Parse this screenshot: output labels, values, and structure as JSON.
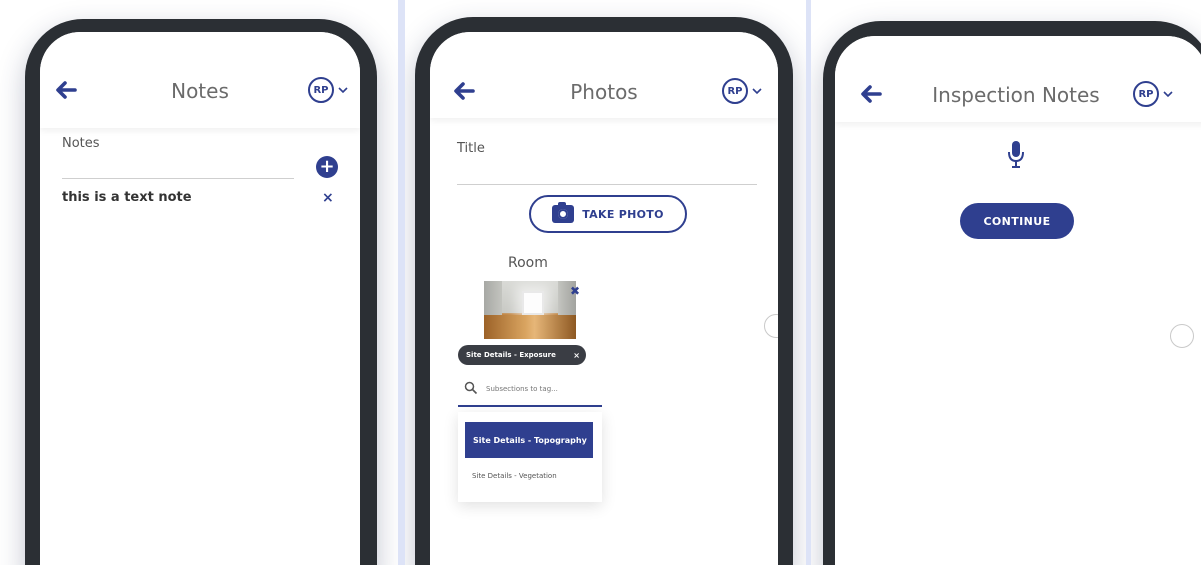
{
  "screens": [
    {
      "title": "Notes",
      "avatar": "RP",
      "notes_label": "Notes",
      "note_items": [
        {
          "text": "this is a text note",
          "remove": "×"
        }
      ],
      "add_symbol": "+"
    },
    {
      "title": "Photos",
      "avatar": "RP",
      "title_label": "Title",
      "take_photo_label": "TAKE PHOTO",
      "room_label": "Room",
      "photo_remove": "✖",
      "tag_chip": {
        "label": "Site Details - Exposure",
        "remove": "×"
      },
      "search_placeholder": "Subsections to tag...",
      "dropdown_options": [
        {
          "label": "Site Details - Topography",
          "selected": true
        },
        {
          "label": "Site Details - Vegetation",
          "selected": false
        }
      ]
    },
    {
      "title": "Inspection Notes",
      "avatar": "RP",
      "continue_label": "CONTINUE"
    }
  ],
  "colors": {
    "accent": "#2f3f8f",
    "frame": "#2b2f34",
    "background": "#dde3f7"
  },
  "icons": [
    "back-arrow-icon",
    "chevron-down-icon",
    "add-circle-icon",
    "close-icon",
    "camera-icon",
    "search-icon",
    "microphone-icon"
  ]
}
